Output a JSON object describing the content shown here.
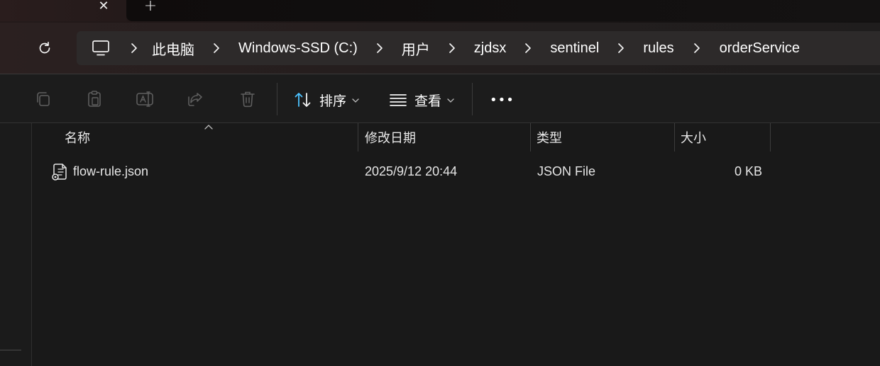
{
  "tabs": {
    "close_glyph": "✕",
    "new_tab_glyph": "+"
  },
  "address": {
    "breadcrumbs": [
      "此电脑",
      "Windows-SSD (C:)",
      "用户",
      "zjdsx",
      "sentinel",
      "rules",
      "orderService"
    ]
  },
  "toolbar": {
    "sort_label": "排序",
    "view_label": "查看",
    "more_glyph": "•••"
  },
  "columns": {
    "name": "名称",
    "modified": "修改日期",
    "type": "类型",
    "size": "大小"
  },
  "files": [
    {
      "name": "flow-rule.json",
      "modified": "2025/9/12 20:44",
      "type": "JSON File",
      "size": "0 KB"
    }
  ],
  "colors": {
    "accent": "#4cc2ff",
    "background": "#191919"
  }
}
